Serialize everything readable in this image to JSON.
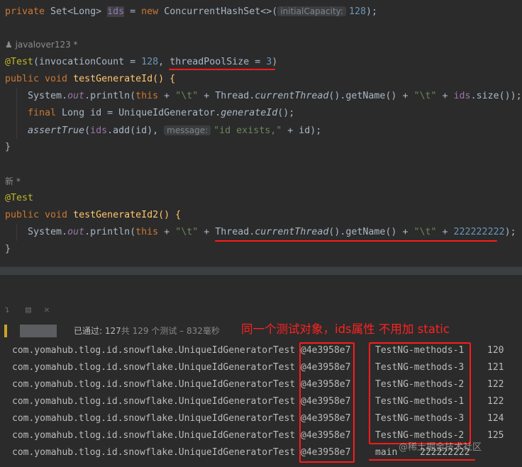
{
  "code": {
    "l1": {
      "private": "private ",
      "type": "Set<Long> ",
      "ids": "ids",
      "eq": " = ",
      "new": "new ",
      "ctor": "ConcurrentHashSet<>(",
      "hint": "initialCapacity:",
      "num": "128",
      "end": ");"
    },
    "author1": "javalover123 *",
    "l2": {
      "ann": "@Test",
      "open": "(invocationCount = ",
      "n1": "128",
      "comma": ", ",
      "tps": "threadPoolSize = ",
      "n2": "3",
      "close": ")"
    },
    "l3": {
      "kw": "public void ",
      "name": "testGenerateId() {"
    },
    "l4": {
      "a": "System.",
      "out": "out",
      "b": ".println(",
      "this": "this",
      "c": " + ",
      "s1": "\"\\t\"",
      "d": " + Thread.",
      "ct": "currentThread",
      "e": "().getName() + ",
      "s2": "\"\\t\"",
      "f": " + ",
      "ids": "ids",
      "g": ".size());"
    },
    "l5": {
      "final": "final ",
      "a": "Long id = UniqueIdGenerator.",
      "gen": "generateId",
      "b": "();"
    },
    "l6": {
      "at": "assertTrue",
      "a": "(",
      "ids": "ids",
      "b": ".add(id), ",
      "hint": "message:",
      "s": "\"id exists,\"",
      "c": " + id);"
    },
    "l7": "}",
    "author2": "新 *",
    "l8": "@Test",
    "l9": {
      "kw": "public void ",
      "name": "testGenerateId2() {"
    },
    "l10": {
      "a": "System.",
      "out": "out",
      "b": ".println(",
      "this": "this",
      "c": " + ",
      "s1": "\"\\t\"",
      "d": " + Thread.",
      "ct": "currentThread",
      "e": "().getName() + ",
      "s2": "\"\\t\"",
      "f": " + ",
      "n": "222222222",
      "g": ");"
    },
    "l11": "}"
  },
  "status": {
    "passed_label": "已通过:",
    "passed_count": "127",
    "rest": "共 129 个测试 – 832毫秒"
  },
  "annotation_note": "同一个测试对象，ids属性 不用加 static",
  "output": {
    "rows": [
      {
        "cls": "com.yomahub.tlog.id.snowflake.UniqueIdGeneratorTest",
        "hash": "@4e3958e7",
        "thread": "TestNG-methods-1",
        "count": "120"
      },
      {
        "cls": "com.yomahub.tlog.id.snowflake.UniqueIdGeneratorTest",
        "hash": "@4e3958e7",
        "thread": "TestNG-methods-3",
        "count": "121"
      },
      {
        "cls": "com.yomahub.tlog.id.snowflake.UniqueIdGeneratorTest",
        "hash": "@4e3958e7",
        "thread": "TestNG-methods-2",
        "count": "122"
      },
      {
        "cls": "com.yomahub.tlog.id.snowflake.UniqueIdGeneratorTest",
        "hash": "@4e3958e7",
        "thread": "TestNG-methods-1",
        "count": "122"
      },
      {
        "cls": "com.yomahub.tlog.id.snowflake.UniqueIdGeneratorTest",
        "hash": "@4e3958e7",
        "thread": "TestNG-methods-3",
        "count": "124"
      },
      {
        "cls": "com.yomahub.tlog.id.snowflake.UniqueIdGeneratorTest",
        "hash": "@4e3958e7",
        "thread": "TestNG-methods-2",
        "count": "125"
      },
      {
        "cls": "com.yomahub.tlog.id.snowflake.UniqueIdGeneratorTest",
        "hash": "@4e3958e7",
        "thread": "main",
        "count": "222222222"
      }
    ]
  },
  "watermark": "@稀土掘金技术社区",
  "colors": {
    "background": "#2b2b2b",
    "keyword": "#cc7832",
    "annotation": "#bbb529",
    "number": "#6897bb",
    "string": "#6a8759",
    "field": "#9876aa",
    "red_markup": "#ff1a1a"
  },
  "icons": [
    "user-icon",
    "scroll-to-end-icon",
    "print-icon",
    "clear-icon"
  ]
}
